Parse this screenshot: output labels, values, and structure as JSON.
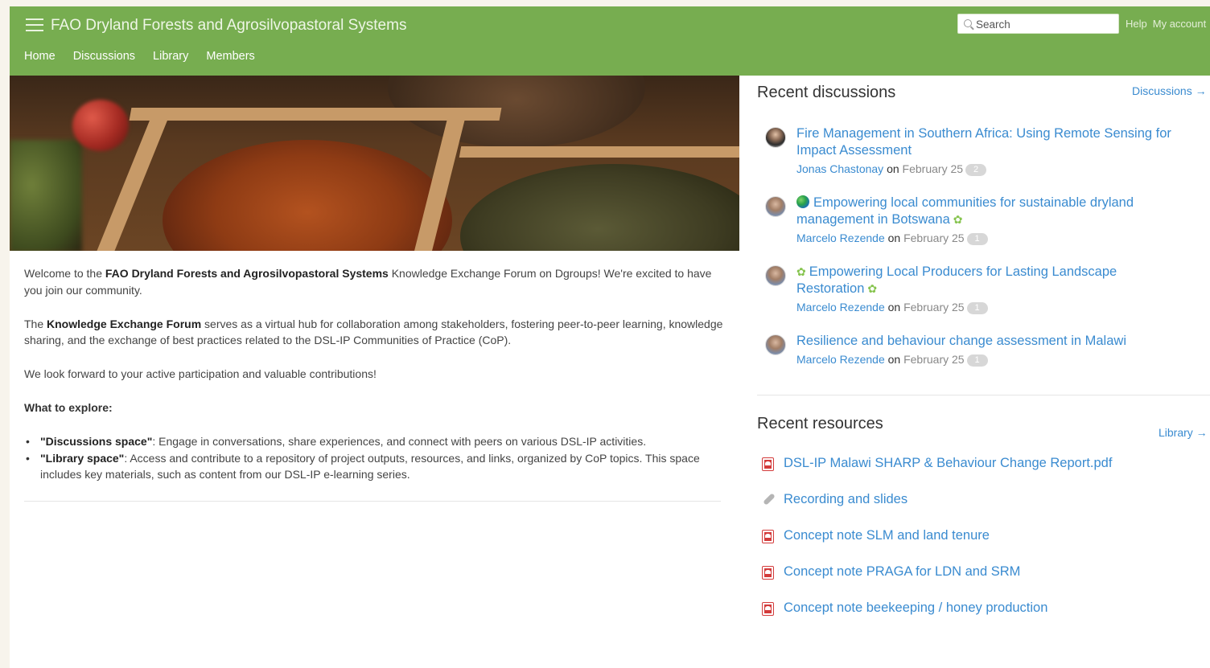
{
  "header": {
    "site_title": "FAO Dryland Forests and Agrosilvopastoral Systems",
    "nav": [
      "Home",
      "Discussions",
      "Library",
      "Members"
    ],
    "search_placeholder": "Search",
    "help_label": "Help",
    "account_label": "My account",
    "color": "#77ad50"
  },
  "welcome": {
    "p1_pre": "Welcome to the ",
    "p1_bold": "FAO Dryland Forests and Agrosilvopastoral Systems",
    "p1_post": " Knowledge Exchange Forum on Dgroups! We're excited to have you join our community.",
    "p2_pre": "The ",
    "p2_bold": "Knowledge Exchange Forum",
    "p2_post": " serves as a virtual hub for collaboration among stakeholders, fostering peer-to-peer learning, knowledge sharing, and the exchange of best practices related to the DSL-IP Communities of Practice (CoP).",
    "p3": "We look forward to your active participation and valuable contributions!",
    "explore_title": "What to explore:",
    "bullet1_bold": "\"Discussions space\"",
    "bullet1_text": ": Engage in conversations, share experiences, and connect with peers on various DSL-IP activities.",
    "bullet2_bold": "\"Library space\"",
    "bullet2_text": ": Access and contribute to a repository of project outputs, resources, and links, organized by CoP topics. This space includes key materials, such as content from our DSL-IP e-learning series."
  },
  "recent_discussions": {
    "title": "Recent discussions",
    "link": "Discussions →",
    "on_word": "on",
    "items": [
      {
        "title": "Fire Management in Southern Africa: Using Remote Sensing for Impact Assessment",
        "author": "Jonas Chastonay",
        "date": "February 25",
        "count": "2"
      },
      {
        "title": "Empowering local communities for sustainable dryland management in Botswana",
        "author": "Marcelo Rezende",
        "date": "February 25",
        "count": "1"
      },
      {
        "title": "Empowering Local Producers for Lasting Landscape Restoration",
        "author": "Marcelo Rezende",
        "date": "February 25",
        "count": "1"
      },
      {
        "title": "Resilience and behaviour change assessment in Malawi",
        "author": "Marcelo Rezende",
        "date": "February 25",
        "count": "1"
      }
    ]
  },
  "recent_resources": {
    "title": "Recent resources",
    "link": "Library →",
    "items": [
      {
        "title": "DSL-IP Malawi SHARP & Behaviour Change Report.pdf",
        "icon": "pdf-icon"
      },
      {
        "title": "Recording and slides",
        "icon": "link-icon"
      },
      {
        "title": "Concept note SLM and land tenure",
        "icon": "pdf-icon"
      },
      {
        "title": "Concept note PRAGA for LDN and SRM",
        "icon": "pdf-icon"
      },
      {
        "title": "Concept note beekeeping / honey production",
        "icon": "pdf-icon"
      }
    ]
  }
}
